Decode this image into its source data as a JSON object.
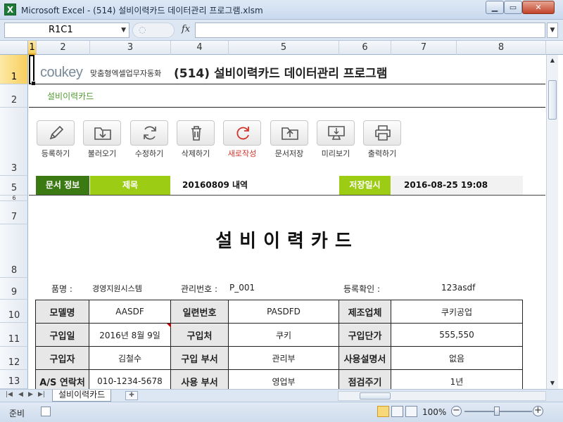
{
  "window": {
    "app_icon": "excel-icon",
    "title": "Microsoft Excel - (514) 설비이력카드 데이터관리 프로그램.xlsm"
  },
  "formula_bar": {
    "name_box": "R1C1",
    "fx_label": "fx",
    "formula": ""
  },
  "columns": [
    "1",
    "2",
    "3",
    "4",
    "5",
    "6",
    "7",
    "8"
  ],
  "rows": [
    "1",
    "2",
    "3",
    "5",
    "6",
    "7",
    "8",
    "9",
    "10",
    "11",
    "12",
    "13"
  ],
  "header": {
    "logo_main": "coukey",
    "logo_sub": "맞춤형엑셀업무자동화",
    "app_title": "(514) 설비이력카드 데이터관리 프로그램",
    "subtitle": "설비이력카드"
  },
  "toolbar": [
    {
      "label": "등록하기",
      "icon": "pencil-icon"
    },
    {
      "label": "불러오기",
      "icon": "folder-download-icon"
    },
    {
      "label": "수정하기",
      "icon": "refresh-icon"
    },
    {
      "label": "삭제하기",
      "icon": "trash-icon"
    },
    {
      "label": "새로작성",
      "icon": "new-icon"
    },
    {
      "label": "문서저장",
      "icon": "folder-upload-icon"
    },
    {
      "label": "미리보기",
      "icon": "monitor-icon"
    },
    {
      "label": "출력하기",
      "icon": "printer-icon"
    }
  ],
  "doc_info": {
    "label": "문서 정보",
    "title_label": "제목",
    "title_value": "20160809 내역",
    "saved_label": "저장일시",
    "saved_value": "2016-08-25 19:08"
  },
  "card": {
    "title": "설비이력카드",
    "item_label": "품명 :",
    "item_value": "경영지원시스템",
    "mgmt_label": "관리번호 :",
    "mgmt_value": "P_001",
    "reg_label": "등록확인 :",
    "reg_value": "123asdf"
  },
  "table": [
    [
      "모델명",
      "AASDF",
      "일련번호",
      "PASDFD",
      "제조업체",
      "쿠키공업"
    ],
    [
      "구입일",
      "2016년 8월 9일",
      "구입처",
      "쿠키",
      "구입단가",
      "555,550"
    ],
    [
      "구입자",
      "김철수",
      "구입 부서",
      "관리부",
      "사용설명서",
      "없음"
    ],
    [
      "A/S 연락처",
      "010-1234-5678",
      "사용 부서",
      "영업부",
      "점검주기",
      "1년"
    ]
  ],
  "sheet_tab": "설비이력카드",
  "status": {
    "ready": "준비",
    "zoom": "100%"
  },
  "colors": {
    "brand_green": "#4f9a2e",
    "info_dark_green": "#3b7a12",
    "info_light_green": "#9ccc13",
    "accent_red": "#d0332a"
  }
}
